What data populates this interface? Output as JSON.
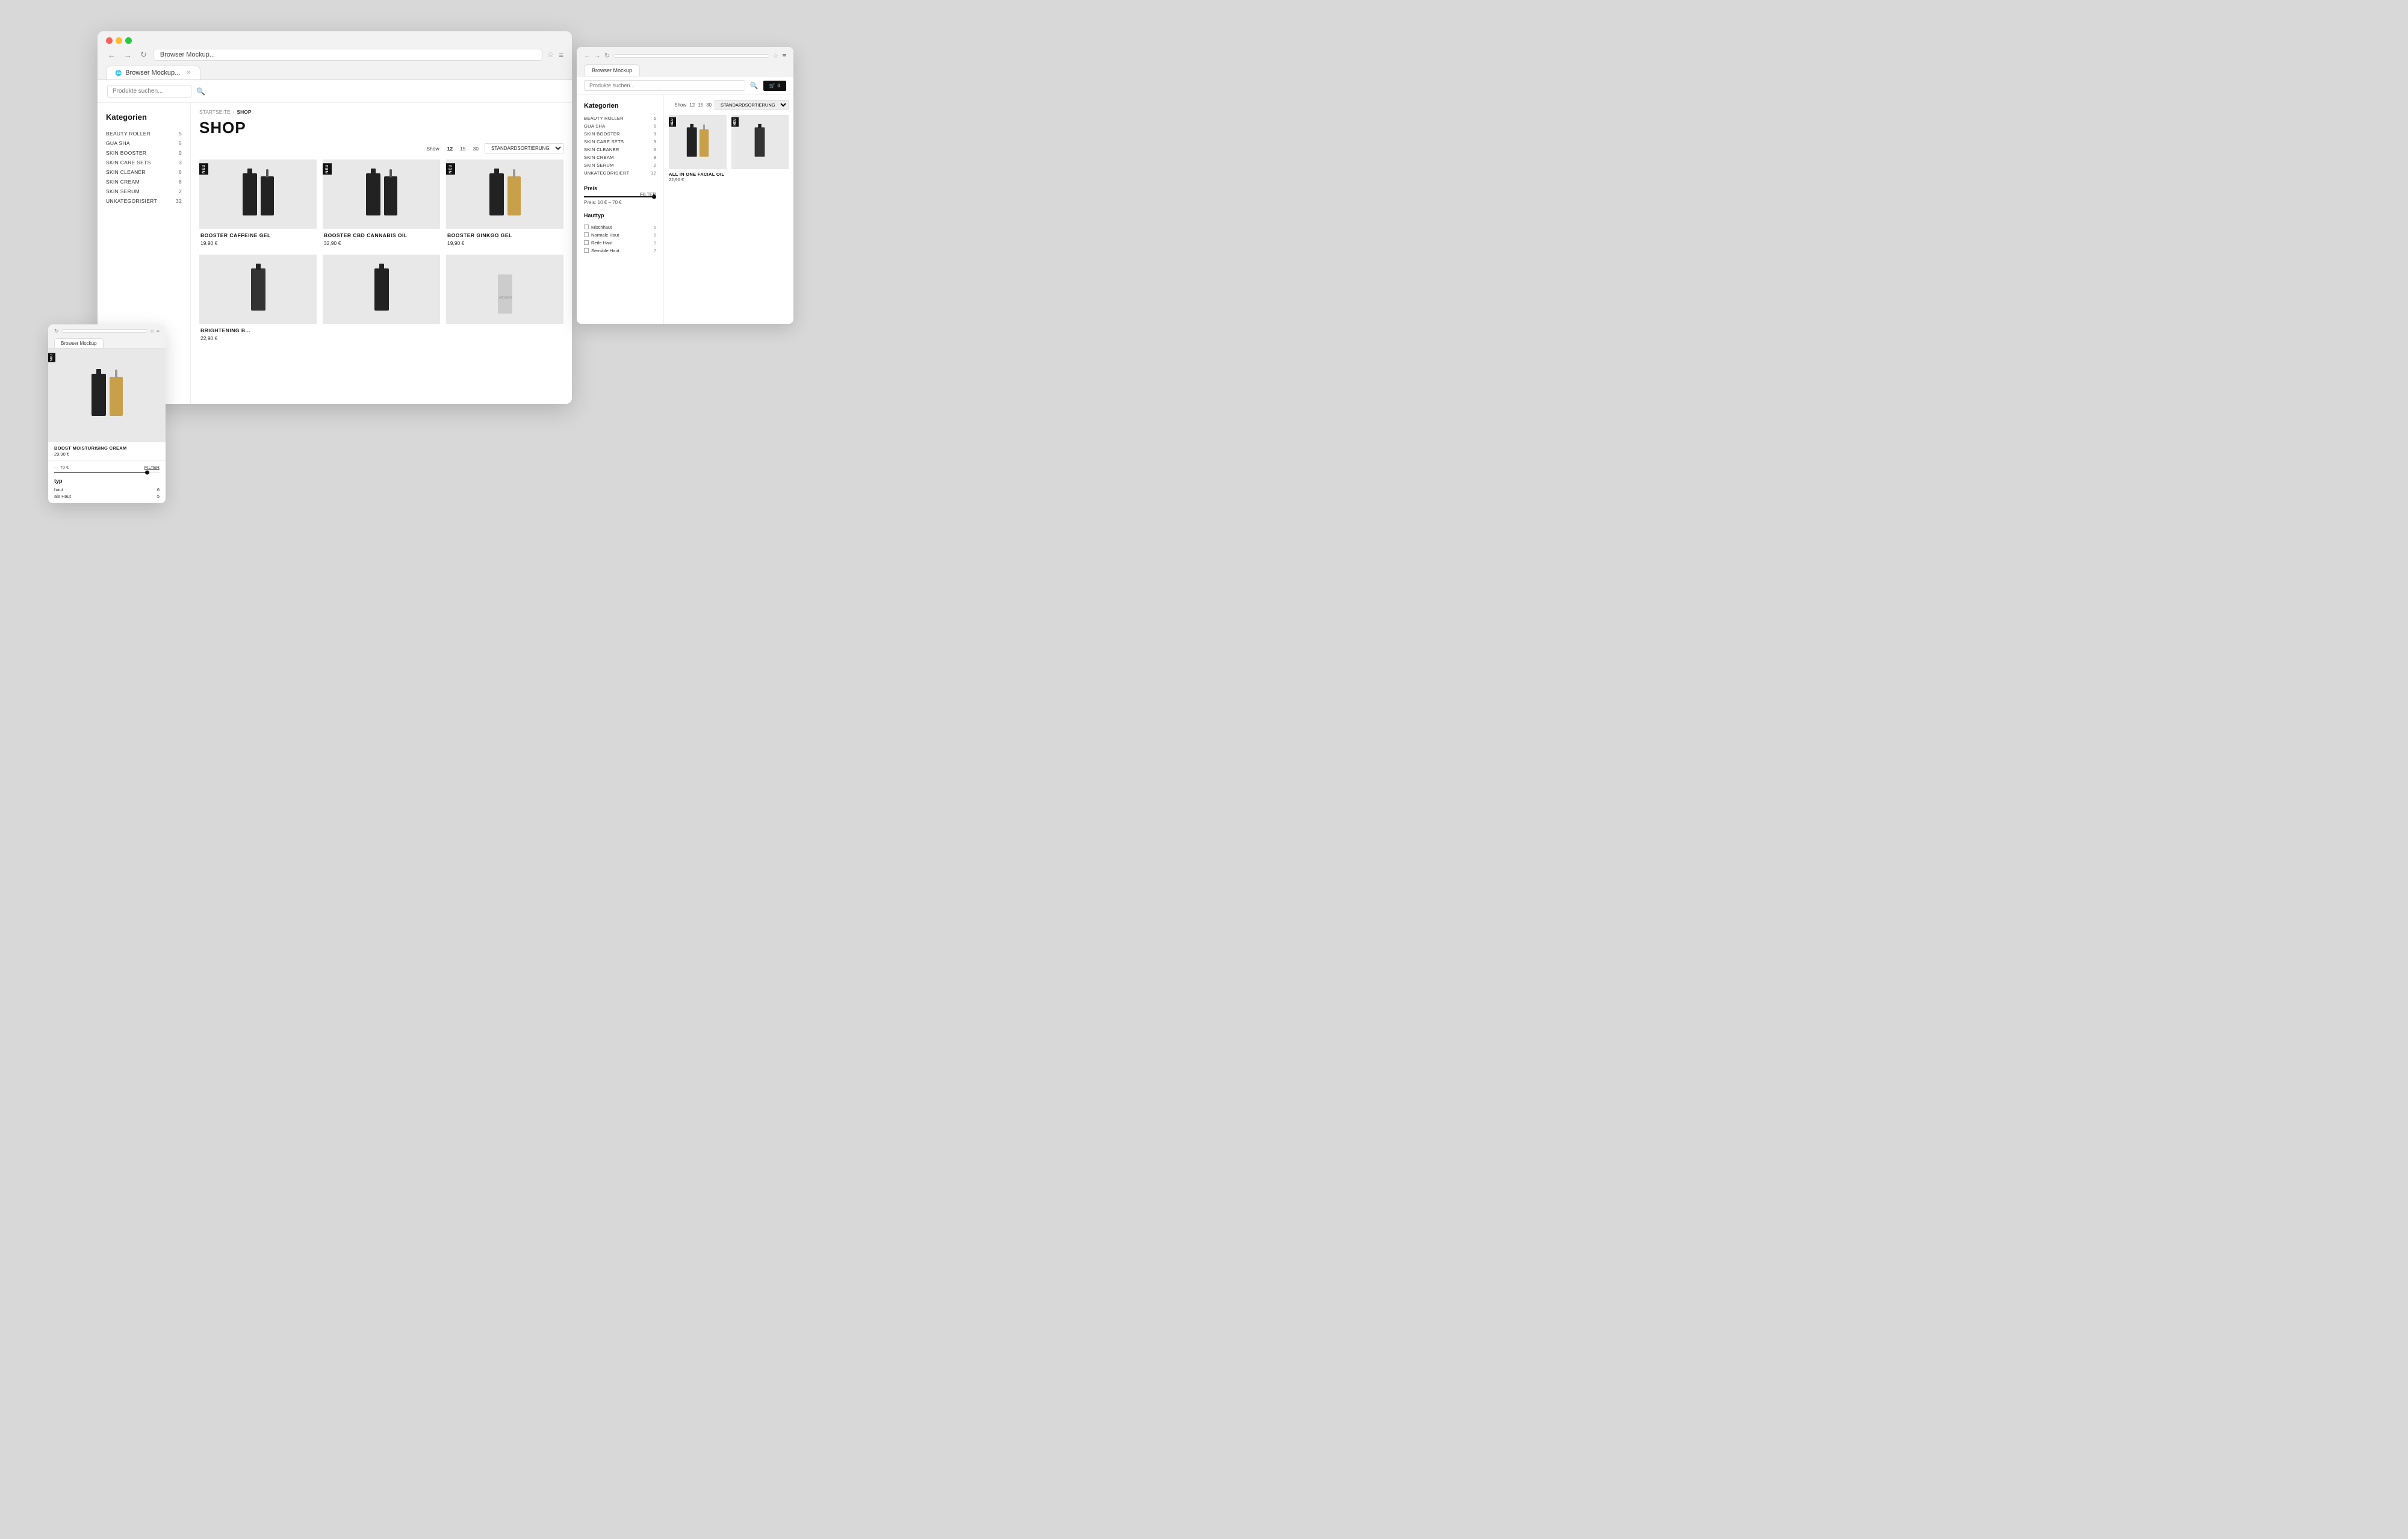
{
  "page": {
    "background": "#d8d8d8"
  },
  "main_browser": {
    "title": "Browser Mockup...",
    "tab_label": "Browser Mockup...",
    "search_placeholder": "Produkte suchen...",
    "breadcrumb": [
      "STARTSEITE",
      "SHOP"
    ],
    "shop_title": "SHOP",
    "toolbar": {
      "show_label": "Show",
      "show_options": [
        "12",
        "15",
        "30"
      ],
      "sort_label": "STANDARDSORTIERUNG"
    },
    "categories_title": "Kategorien",
    "categories": [
      {
        "name": "BEAUTY ROLLER",
        "count": "5"
      },
      {
        "name": "GUA SHA",
        "count": "5"
      },
      {
        "name": "SKIN BOOSTER",
        "count": "9"
      },
      {
        "name": "SKIN CARE SETS",
        "count": "3"
      },
      {
        "name": "SKIN CLEANER",
        "count": "6"
      },
      {
        "name": "SKIN CREAM",
        "count": "8"
      },
      {
        "name": "SKIN SERUM",
        "count": "2"
      },
      {
        "name": "UNKATEGORISIERT",
        "count": "32"
      }
    ],
    "products": [
      {
        "name": "BOOSTER CAFFEINE GEL",
        "price": "19,90 €",
        "badge": "NEU"
      },
      {
        "name": "BOOSTER CBD CANNABIS OIL",
        "price": "32,90 €",
        "badge": "NEU"
      },
      {
        "name": "BOOSTER GINKGO GEL",
        "price": "19,90 €",
        "badge": "NEU"
      },
      {
        "name": "BRIGHTENING B...",
        "price": "22,90 €",
        "badge": ""
      },
      {
        "name": "",
        "price": "",
        "badge": ""
      },
      {
        "name": "",
        "price": "",
        "badge": ""
      },
      {
        "name": "",
        "price": "",
        "badge": ""
      }
    ]
  },
  "tablet_browser": {
    "title": "Browser Mockup",
    "search_placeholder": "Produkte suchen...",
    "cart_label": "0",
    "categories_title": "Kategorien",
    "categories": [
      {
        "name": "BEAUTY ROLLER",
        "count": "5"
      },
      {
        "name": "GUA SHA",
        "count": "5"
      },
      {
        "name": "SKIN BOOSTER",
        "count": "9"
      },
      {
        "name": "SKIN CARE SETS",
        "count": "3"
      },
      {
        "name": "SKIN CLEANER",
        "count": "6"
      },
      {
        "name": "SKIN CREAM",
        "count": "8"
      },
      {
        "name": "SKIN SERUM",
        "count": "2"
      },
      {
        "name": "UNKATEGORISIERT",
        "count": "32"
      }
    ],
    "price_section": {
      "title": "Preis",
      "label": "Preis: 10 € – 70 €",
      "filter_link": "FILTER"
    },
    "hauttyp_section": {
      "title": "Hauttyp",
      "options": [
        {
          "name": "Mischhaut",
          "count": "6"
        },
        {
          "name": "Normale Haut",
          "count": "5"
        },
        {
          "name": "Reife Haut",
          "count": "1"
        },
        {
          "name": "Sensible Haut",
          "count": "7"
        }
      ]
    },
    "sort_label": "STANDARDSORTIERUNG",
    "products": [
      {
        "name": "ALL IN ONE FACIAL OIL",
        "price": "22,90 €",
        "badge": "NEU"
      },
      {
        "name": "",
        "price": "",
        "badge": "NEU"
      }
    ]
  },
  "mobile_browser": {
    "title": "Browser Mockup",
    "featured_product": {
      "name": "BOOST MOISTURISING CREAM",
      "price": "29,90 €",
      "badge": "NEU"
    },
    "price_section": {
      "label": "— 70 €",
      "filter_link": "FILTER"
    },
    "typ_section": {
      "title": "typ",
      "options": [
        {
          "name": "haut",
          "count": "6"
        },
        {
          "name": "ale Haut",
          "count": "5"
        }
      ]
    }
  }
}
